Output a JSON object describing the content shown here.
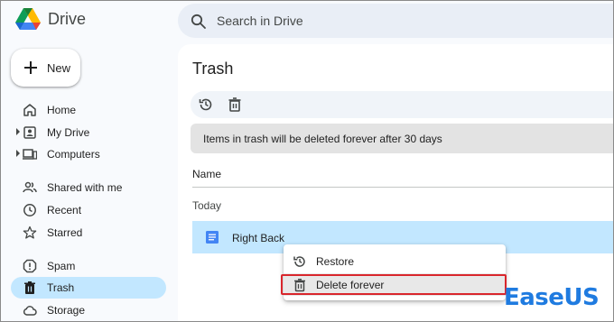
{
  "app": {
    "title": "Drive"
  },
  "search": {
    "placeholder": "Search in Drive"
  },
  "new_button": {
    "label": "New"
  },
  "sidebar": {
    "items": [
      {
        "label": "Home",
        "icon": "home-icon"
      },
      {
        "label": "My Drive",
        "icon": "my-drive-icon"
      },
      {
        "label": "Computers",
        "icon": "computers-icon"
      },
      {
        "label": "Shared with me",
        "icon": "shared-icon"
      },
      {
        "label": "Recent",
        "icon": "clock-icon"
      },
      {
        "label": "Starred",
        "icon": "star-icon"
      },
      {
        "label": "Spam",
        "icon": "spam-icon"
      },
      {
        "label": "Trash",
        "icon": "trash-icon",
        "active": true
      },
      {
        "label": "Storage",
        "icon": "cloud-icon"
      }
    ]
  },
  "main": {
    "title": "Trash",
    "toolbar": {
      "icons": [
        "restore-icon",
        "trash-icon"
      ]
    },
    "banner": "Items in trash will be deleted forever after 30 days",
    "column_header": "Name",
    "section_label": "Today",
    "file": {
      "name": "Right Back",
      "icon": "docs-icon"
    }
  },
  "context_menu": {
    "items": [
      {
        "label": "Restore",
        "icon": "restore-icon"
      },
      {
        "label": "Delete forever",
        "icon": "trash-icon"
      }
    ]
  },
  "watermark": {
    "text": "EaseUS"
  },
  "colors": {
    "accent": "#c2e7ff",
    "highlight_border": "#d9262c",
    "watermark": "#1f7be0"
  }
}
